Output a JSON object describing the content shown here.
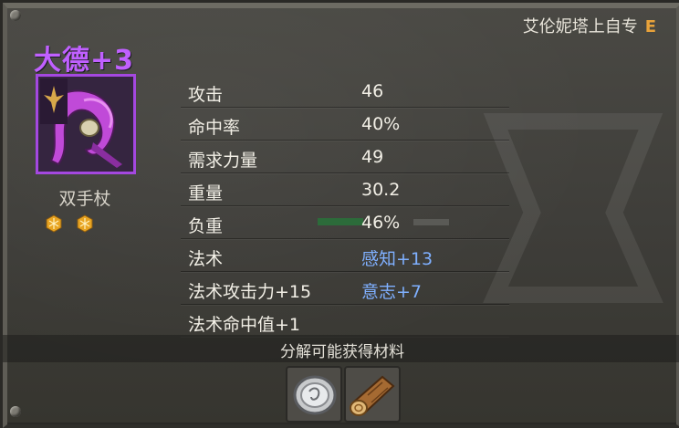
{
  "header": {
    "owner_label": "艾伦妮塔上自专",
    "grade": "E"
  },
  "item": {
    "name": "大德+3",
    "type": "双手杖",
    "gem_count": 2
  },
  "stats": [
    {
      "label": "攻击",
      "value": "46",
      "value_color": "white"
    },
    {
      "label": "命中率",
      "value": "40%",
      "value_color": "white"
    },
    {
      "label": "需求力量",
      "value": "49",
      "value_color": "white"
    },
    {
      "label": "重量",
      "value": "30.2",
      "value_color": "white"
    },
    {
      "label": "负重",
      "value": "46%",
      "value_color": "white"
    },
    {
      "label": "法术",
      "value": "感知+13",
      "value_color": "blue"
    },
    {
      "label": "法术攻击力+15",
      "value": "意志+7",
      "value_color": "blue"
    },
    {
      "label": "法术命中值+1",
      "value": "",
      "value_color": "white"
    }
  ],
  "load_progress_fraction": 0.46,
  "footer": {
    "title": "分解可能获得材料",
    "materials": [
      {
        "name": "silver-coin-icon"
      },
      {
        "name": "wood-log-icon"
      }
    ]
  },
  "colors": {
    "item_name": "#c060ff",
    "icon_border": "#a448e0",
    "grade": "#e8a23a",
    "blue_value": "#7fb0ff"
  }
}
